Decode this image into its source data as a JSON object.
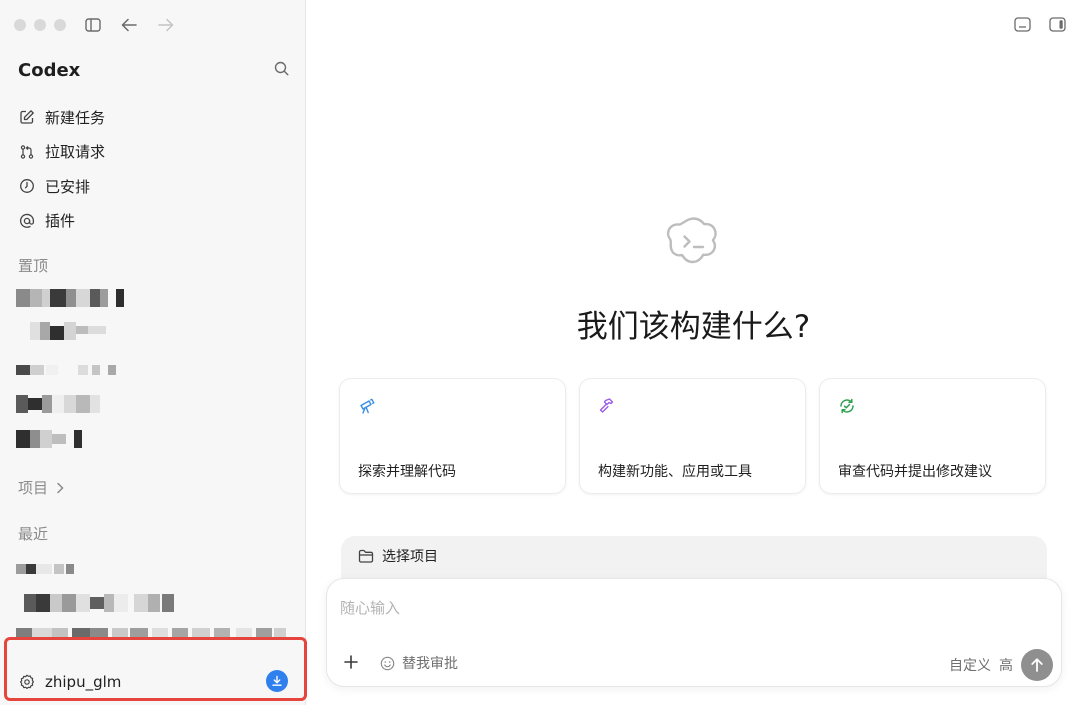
{
  "sidebar": {
    "brand": "Codex",
    "nav": [
      {
        "label": "新建任务",
        "icon": "edit-icon"
      },
      {
        "label": "拉取请求",
        "icon": "pull-request-icon"
      },
      {
        "label": "已安排",
        "icon": "clock-icon"
      },
      {
        "label": "插件",
        "icon": "at-icon"
      }
    ],
    "pinned_label": "置顶",
    "projects_label": "项目",
    "recent_label": "最近",
    "user": {
      "name": "zhipu_glm"
    }
  },
  "main": {
    "title": "我们该构建什么?",
    "cards": [
      {
        "label": "探索并理解代码",
        "icon": "telescope-icon",
        "color": "#3b8ee6"
      },
      {
        "label": "构建新功能、应用或工具",
        "icon": "hammer-icon",
        "color": "#9b5de5"
      },
      {
        "label": "审查代码并提出修改建议",
        "icon": "review-icon",
        "color": "#2ea04f"
      }
    ],
    "project_selector": "选择项目",
    "composer": {
      "placeholder": "随心输入",
      "approval": "替我审批",
      "mode": "自定义",
      "level": "高"
    }
  },
  "colors": {
    "accent": "#2f80ed",
    "highlight_border": "#e5453d",
    "sidebar_bg": "#f7f7f7"
  }
}
